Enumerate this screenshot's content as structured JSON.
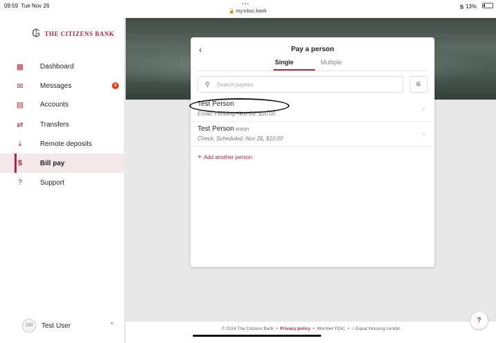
{
  "status_bar": {
    "time": "09:59",
    "date": "Tue Nov 26",
    "dots": "•••",
    "url": "my.tcbsc.bank",
    "battery": "13%",
    "icons": [
      "wifi-icon",
      "lock-icon",
      "battery-icon"
    ]
  },
  "brand": {
    "name": "THE CITIZENS BANK",
    "accent_color": "#b0283a"
  },
  "sidebar": {
    "items": [
      {
        "label": "Dashboard",
        "icon": "dashboard-icon"
      },
      {
        "label": "Messages",
        "icon": "envelope-icon",
        "badge": "8"
      },
      {
        "label": "Accounts",
        "icon": "accounts-icon"
      },
      {
        "label": "Transfers",
        "icon": "transfer-arrows-icon"
      },
      {
        "label": "Remote deposits",
        "icon": "deposit-icon"
      },
      {
        "label": "Bill pay",
        "icon": "bill-pay-icon",
        "active": true
      },
      {
        "label": "Support",
        "icon": "question-circle-icon"
      }
    ],
    "user": {
      "initials": "SM",
      "name": "Test User"
    }
  },
  "dialog": {
    "title": "Pay a person",
    "tabs": [
      "Single",
      "Multiple"
    ],
    "active_tab": "Single",
    "search_placeholder": "Search payees",
    "payees": [
      {
        "name": "Test Person",
        "extra": "",
        "detail": "Email, Pending: Nov 26, $10.00"
      },
      {
        "name": "Test Person",
        "extra": "xrson",
        "detail": "Check, Scheduled: Nov 26, $10.00"
      }
    ],
    "add_label": "Add another person"
  },
  "footer": {
    "copyright": "© 2024 The Citizens Bank",
    "privacy": "Privacy policy",
    "fdic": "Member FDIC",
    "housing": "Equal Housing Lender",
    "sep": "•"
  },
  "help_label": "?"
}
